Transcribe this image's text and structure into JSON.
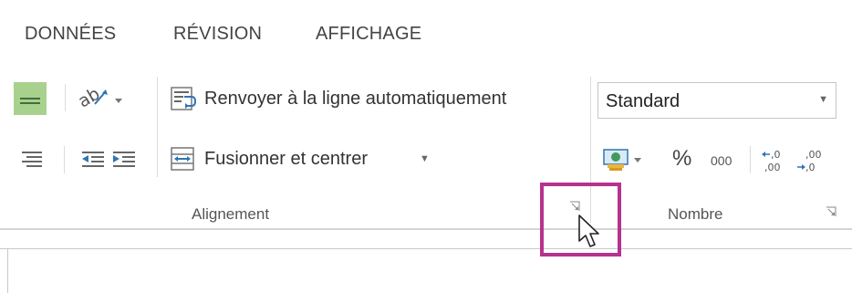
{
  "tabs": [
    "DONNÉES",
    "RÉVISION",
    "AFFICHAGE"
  ],
  "alignment": {
    "wrap_text_label": "Renvoyer à la ligne automatiquement",
    "merge_center_label": "Fusionner et centrer",
    "group_label": "Alignement"
  },
  "number": {
    "format_value": "Standard",
    "percent_label": "%",
    "thousands_label": "000",
    "increase_decimal_label": ",0 ,00",
    "decrease_decimal_label": ",00 ,0",
    "group_label": "Nombre"
  },
  "colors": {
    "highlight": "#b6328f",
    "selected_button": "#a9d18e",
    "icon_green": "#3f9a5b",
    "icon_blue": "#2e75b6"
  }
}
